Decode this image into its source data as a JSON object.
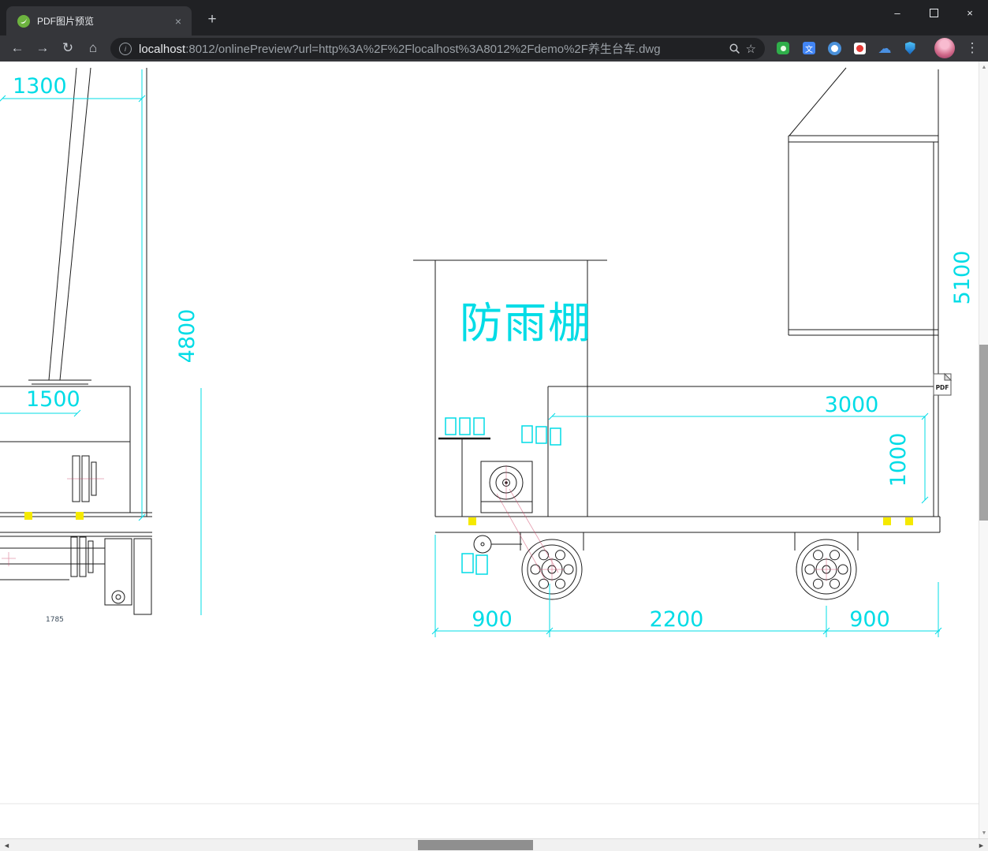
{
  "browser": {
    "tab": {
      "title": "PDF图片预览",
      "close_icon": "×"
    },
    "new_tab_icon": "+",
    "window_controls": {
      "minimize": "–",
      "close": "×"
    },
    "nav": {
      "back": "←",
      "forward": "→",
      "reload": "↻",
      "home": "⌂"
    },
    "omnibox": {
      "info_icon": "i",
      "url_host": "localhost",
      "url_rest": ":8012/onlinePreview?url=http%3A%2F%2Flocalhost%3A8012%2Fdemo%2F养生台车.dwg",
      "star_icon": "☆"
    },
    "extensions": {
      "translate_glyph": "文",
      "cloud_glyph": "☁"
    },
    "menu_icon": "⋮",
    "scroll": {
      "left_arrow": "◄",
      "right_arrow": "►",
      "up_arrow": "▲",
      "down_arrow": "▼"
    }
  },
  "drawing": {
    "shelter_label": "防雨棚",
    "dims": {
      "d1300": "1300",
      "d4800": "4800",
      "d1500": "1500",
      "d5100": "5100",
      "d3000": "3000",
      "d1000": "1000",
      "d900_left": "900",
      "d2200": "2200",
      "d900_right": "900",
      "d1785": "1785"
    },
    "pdf_badge": "PDF",
    "colors": {
      "dimension": "#00dce6",
      "geometry": "#1b1b1b",
      "highlight": "#f5e900",
      "centerline": "#cc4466"
    }
  }
}
